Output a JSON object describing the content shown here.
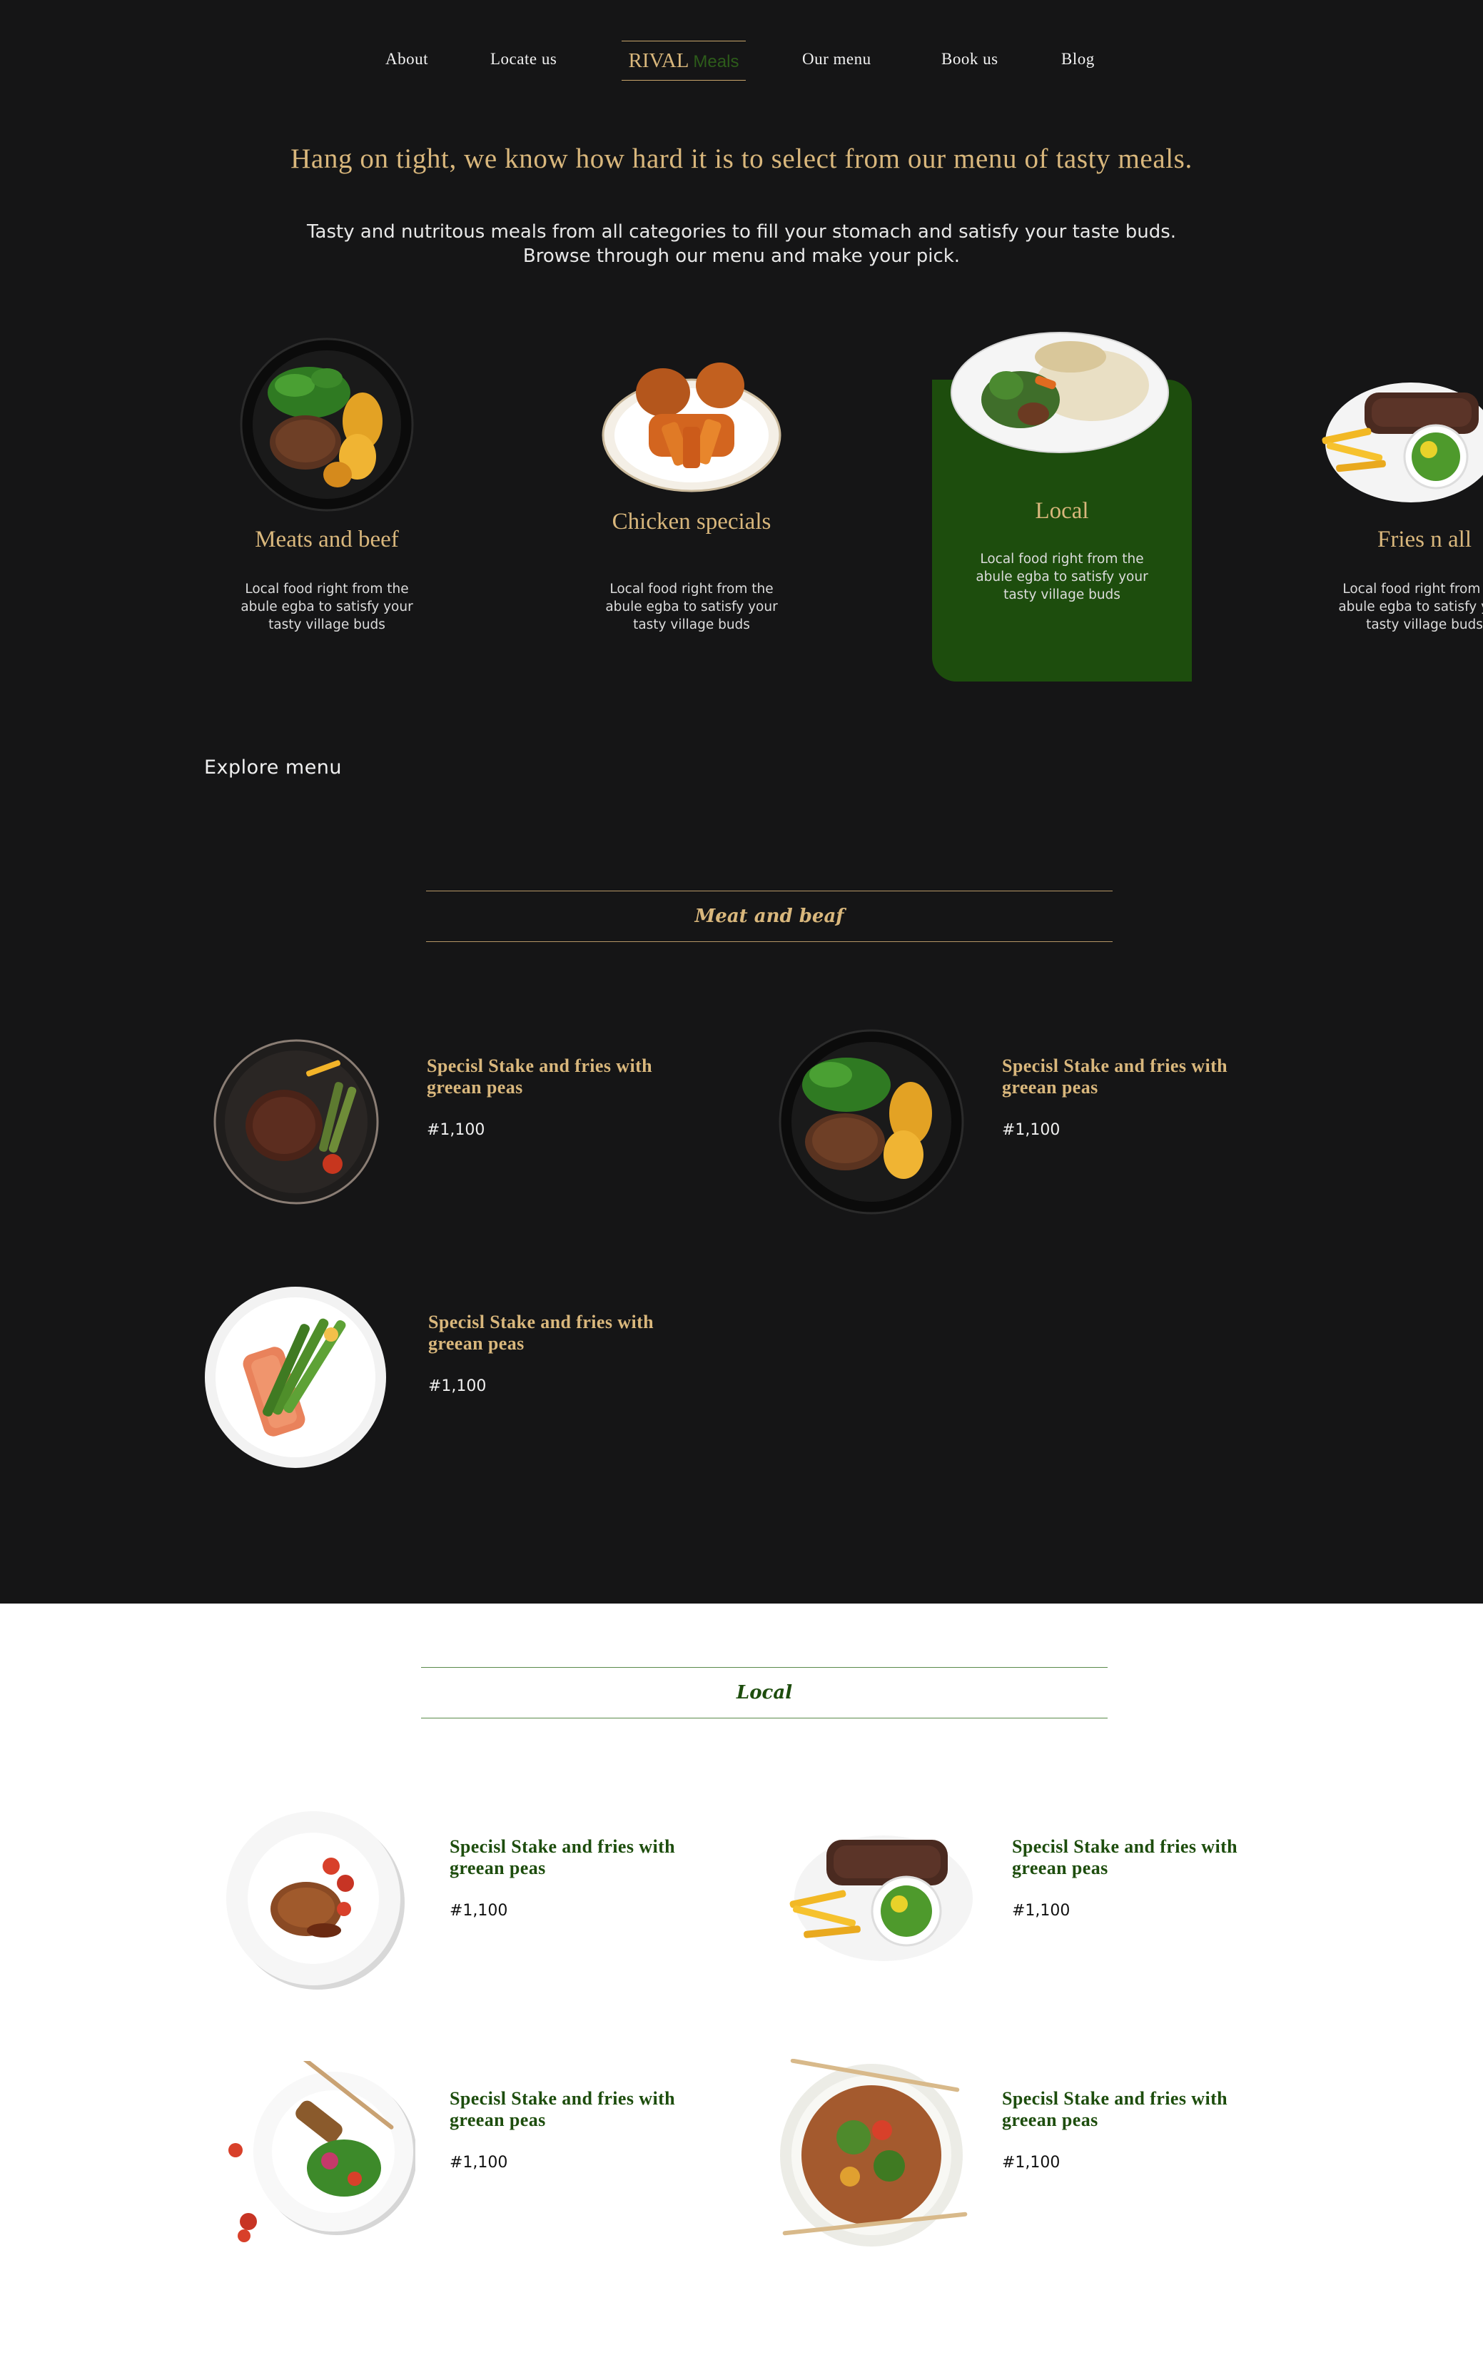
{
  "nav": {
    "items": [
      "About",
      "Locate us",
      "Our menu",
      "Book us",
      "Blog"
    ],
    "logo_main": "RIVAL",
    "logo_sub": "Meals"
  },
  "hero": {
    "headline": "Hang on tight, we know how hard it is to select from our menu of tasty meals.",
    "sub_line1": "Tasty and nutritous meals from all categories to fill your stomach and satisfy your taste buds.",
    "sub_line2": "Browse through our menu and make your pick."
  },
  "categories": [
    {
      "title": "Meats and beef",
      "desc": "Local food right from the abule egba to satisfy your tasty village buds",
      "active": false
    },
    {
      "title": "Chicken specials",
      "desc": "Local food right from the abule egba to satisfy your tasty village buds",
      "active": false
    },
    {
      "title": "Local",
      "desc": "Local food right from the abule egba to satisfy your tasty village buds",
      "active": true
    },
    {
      "title": "Fries n all",
      "desc": "Local food right from the abule egba to satisfy your tasty village buds",
      "active": false
    }
  ],
  "explore_label": "Explore menu",
  "sections": [
    {
      "title": "Meat and beaf",
      "items": [
        {
          "name": "Specisl Stake and fries with greean peas",
          "price": "#1,100"
        },
        {
          "name": "Specisl Stake and fries with greean peas",
          "price": "#1,100"
        },
        {
          "name": "Specisl Stake and fries with greean peas",
          "price": "#1,100"
        }
      ]
    },
    {
      "title": "Local",
      "items": [
        {
          "name": "Specisl Stake and fries with greean peas",
          "price": "#1,100"
        },
        {
          "name": "Specisl Stake and fries with greean peas",
          "price": "#1,100"
        },
        {
          "name": "Specisl Stake and fries with greean peas",
          "price": "#1,100"
        },
        {
          "name": "Specisl Stake and fries with greean peas",
          "price": "#1,100"
        }
      ]
    }
  ],
  "colors": {
    "background_dark": "#151516",
    "gold": "#d9b77c",
    "green": "#1d4d0d"
  }
}
